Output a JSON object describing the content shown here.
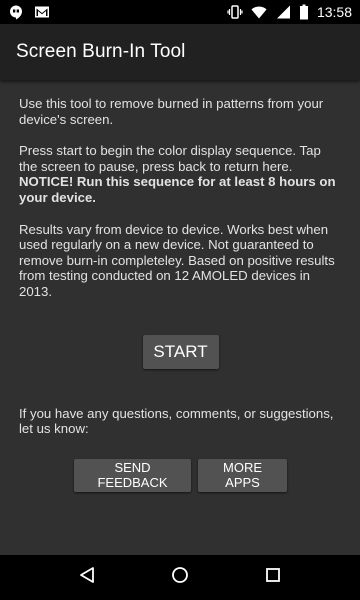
{
  "status_bar": {
    "time": "13:58",
    "left_icons": [
      "hangouts-icon",
      "gmail-icon"
    ],
    "right_icons": [
      "vibrate-icon",
      "wifi-icon",
      "signal-icon",
      "battery-icon"
    ]
  },
  "app_bar": {
    "title": "Screen Burn-In Tool"
  },
  "content": {
    "intro": "Use this tool to remove burned in patterns from your device's screen.",
    "instructions": "Press start to begin the color display sequence. Tap the screen to pause, press back to return here.",
    "notice": "NOTICE! Run this sequence for at least 8 hours on your device.",
    "disclaimer": "Results vary from device to device. Works best when used regularly on a new device. Not guaranteed to remove burn-in completeley. Based on positive results from testing conducted on 12 AMOLED devices in 2013.",
    "start_label": "START",
    "contact_text": "If you have any questions, comments, or suggestions, let us know:",
    "feedback_label": "SEND FEEDBACK",
    "more_apps_label": "MORE APPS"
  },
  "nav_bar": {
    "icons": [
      "back-icon",
      "home-icon",
      "recents-icon"
    ]
  },
  "colors": {
    "app_bar": "#212121",
    "background": "#303030",
    "button": "#525252"
  }
}
